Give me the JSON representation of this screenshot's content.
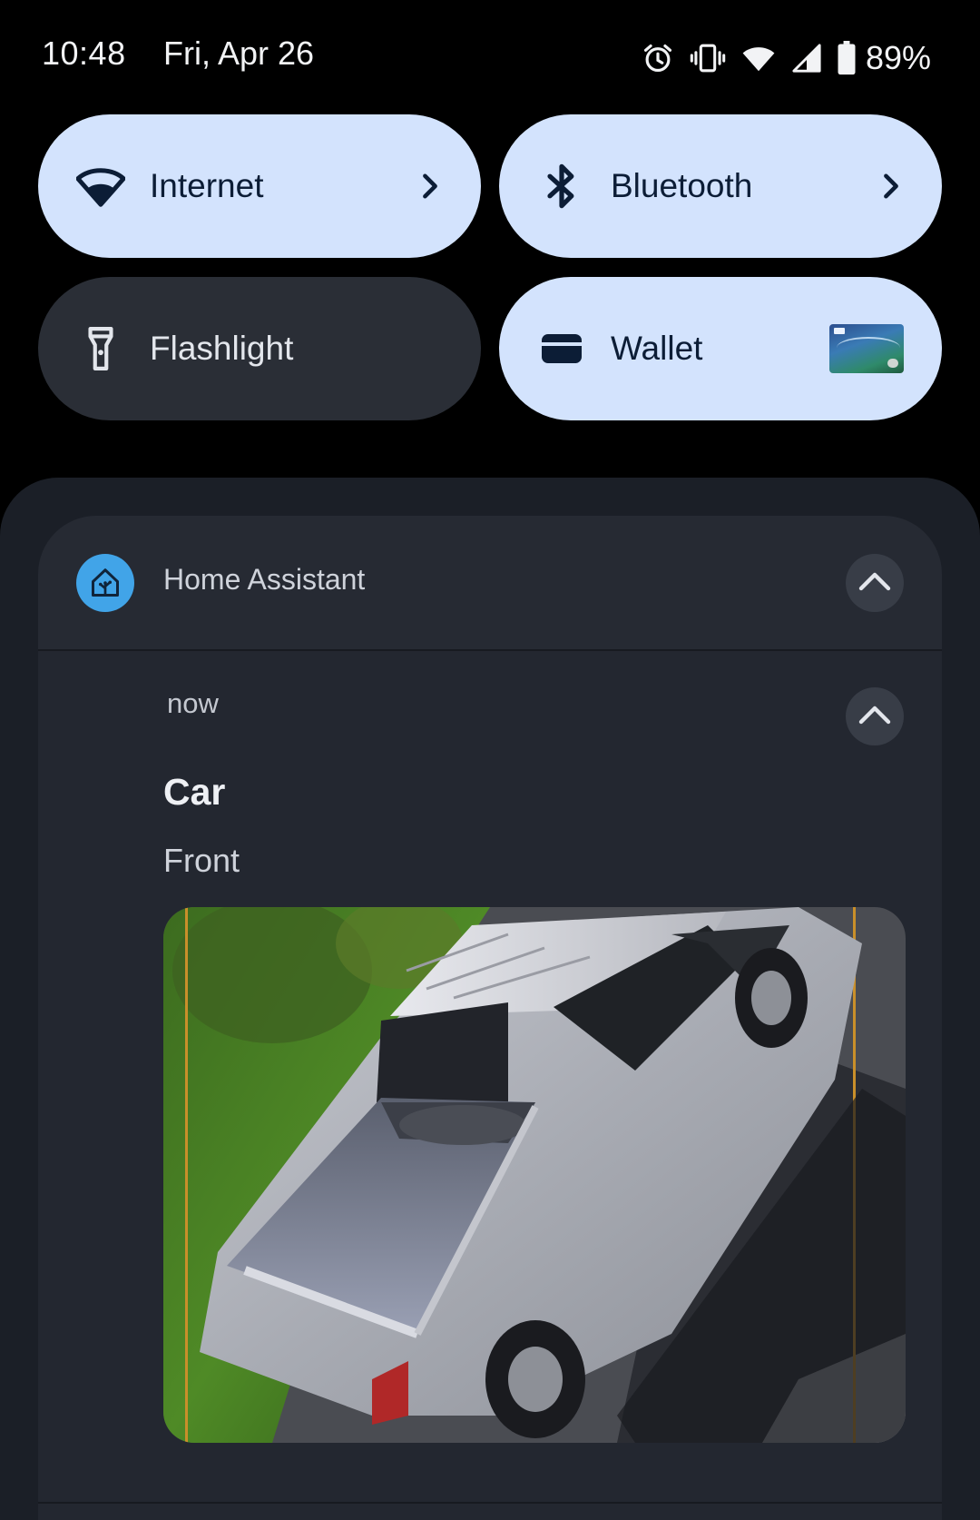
{
  "status_bar": {
    "time": "10:48",
    "date": "Fri, Apr 26",
    "icons": [
      "alarm-icon",
      "vibrate-icon",
      "wifi-icon",
      "cell-signal-icon",
      "battery-icon"
    ],
    "battery_percent": "89%"
  },
  "quick_settings": {
    "tiles": [
      {
        "label": "Internet",
        "icon": "wifi-icon",
        "state": "on",
        "has_chevron": true
      },
      {
        "label": "Bluetooth",
        "icon": "bluetooth-icon",
        "state": "on",
        "has_chevron": true
      },
      {
        "label": "Flashlight",
        "icon": "flashlight-icon",
        "state": "off",
        "has_chevron": false
      },
      {
        "label": "Wallet",
        "icon": "wallet-icon",
        "state": "on",
        "has_chevron": false
      }
    ],
    "colors": {
      "tile_on": "#d3e3fd",
      "tile_off": "#2a2e36"
    }
  },
  "notification": {
    "app_name": "Home Assistant",
    "app_icon": "home-assistant-icon",
    "app_icon_color": "#41a4e8",
    "time": "now",
    "title": "Car",
    "text": "Front",
    "image_subject": "camera snapshot of silver pickup truck"
  }
}
